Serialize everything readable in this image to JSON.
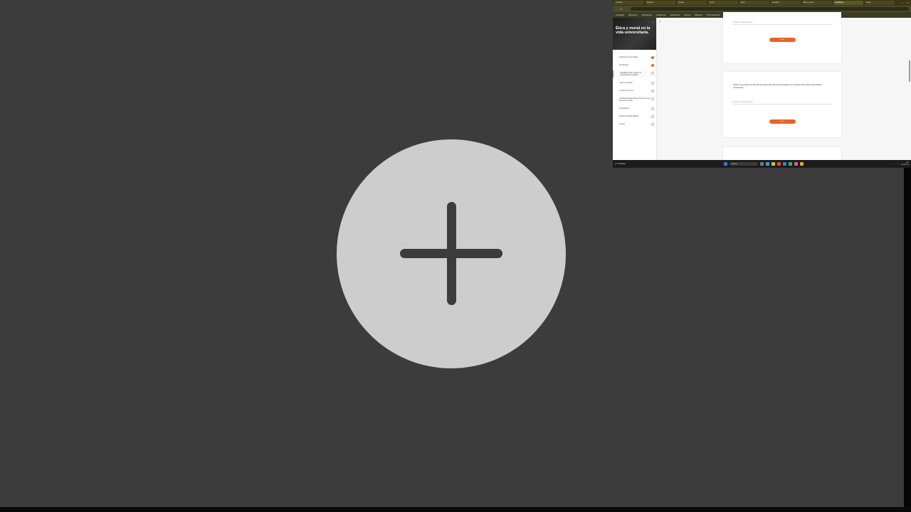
{
  "colors": {
    "background": "#3c3c3c",
    "circle": "#cdcdcd",
    "accent": "#e8622a",
    "taskbar": "#1c1c1c",
    "browser_chrome": "#3a3814"
  },
  "add_button": {
    "icon": "plus-icon"
  },
  "thumbnail": {
    "browser": {
      "tabs": [
        {
          "label": "YouTube"
        },
        {
          "label": "Modulo 1"
        },
        {
          "label": "Google"
        },
        {
          "label": "Curso"
        },
        {
          "label": "Ética"
        },
        {
          "label": "Actividad"
        },
        {
          "label": "Ética y moral"
        },
        {
          "label": "Actividades"
        },
        {
          "label": "Tarea"
        }
      ],
      "url": "…",
      "bookmarks": [
        "Importados",
        "Marcadores",
        "Herramientas",
        "Google Drive",
        "Aplicaciones",
        "Mi curso",
        "Biblioteca",
        "Otros marcadores"
      ]
    },
    "course": {
      "hero_title": "Ética y moral en la vida universitaria.",
      "hero_subtitle": "…",
      "lessons": [
        {
          "label": "Objetivos de aprendizaje",
          "done": true
        },
        {
          "label": "Introducción",
          "done": true
        },
        {
          "label": "Actividad previa: conoce tus conocimientos y analiza",
          "done": false,
          "active": true
        },
        {
          "label": "¿Qué es la ética?",
          "done": false
        },
        {
          "label": "La ética y la moral",
          "done": false
        },
        {
          "label": "Actividad de aprendizaje: Relación de las esferas de la vida",
          "done": false
        },
        {
          "label": "Conclusiones",
          "done": false
        },
        {
          "label": "Referencias bibliográficas",
          "done": false
        },
        {
          "label": "Lección",
          "done": false
        }
      ]
    },
    "cards": {
      "card1": {
        "answer_placeholder": "Escriba su respuesta aquí",
        "submit": "Enviar"
      },
      "card2": {
        "question": "Indica el concepto de ética de las personas y de las sociedades en el ámbito de la vida universitaria y profesional.",
        "answer_placeholder": "Escriba su respuesta aquí",
        "submit": "Enviar"
      }
    },
    "taskbar": {
      "weather": "17°C Nublado",
      "search_placeholder": "Buscar",
      "time": "8:42",
      "date": "24/04/2024"
    }
  }
}
